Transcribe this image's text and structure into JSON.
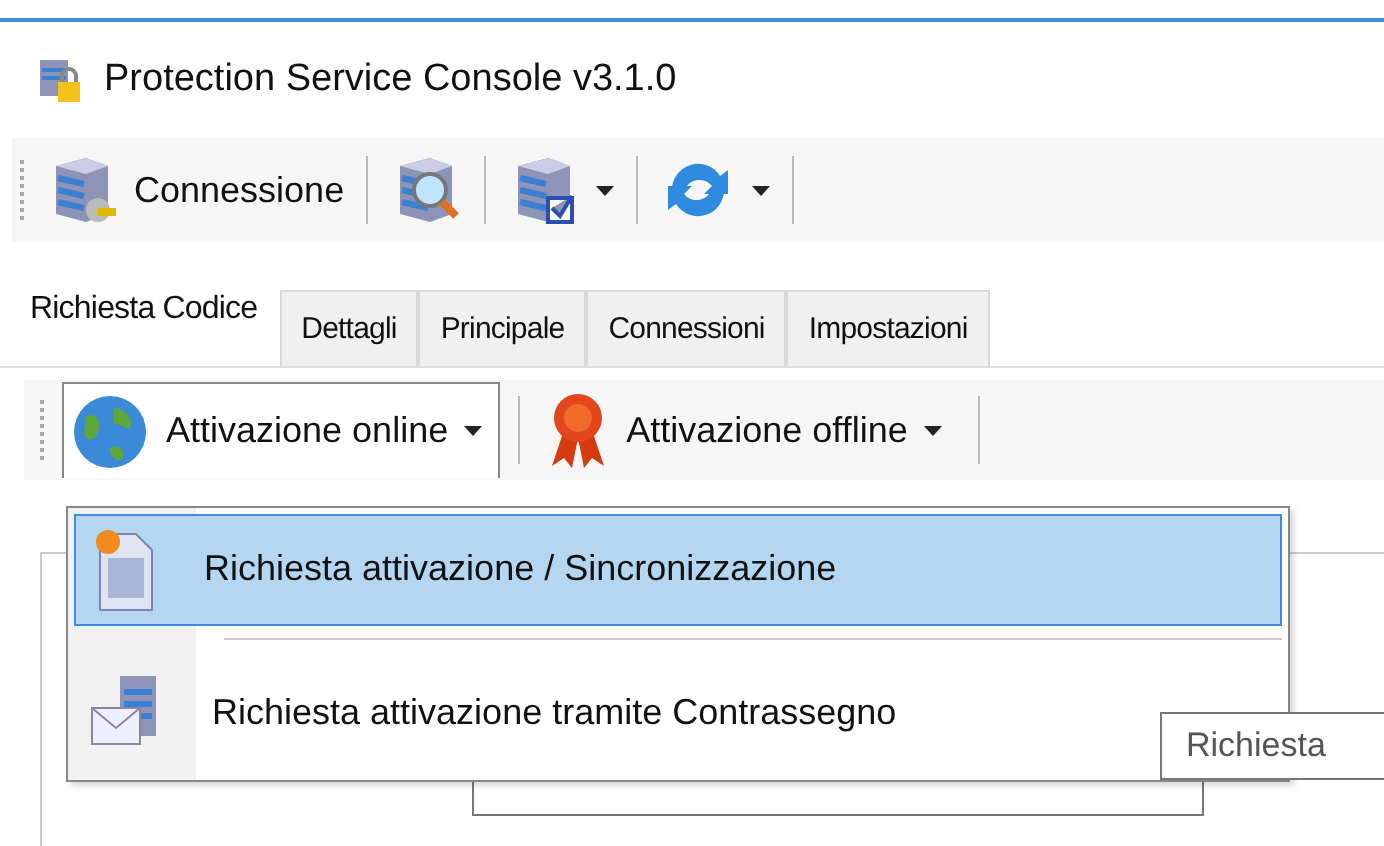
{
  "window": {
    "title": "Protection Service Console v3.1.0"
  },
  "toolbar": {
    "items": [
      {
        "kind": "labeled",
        "label": "Connessione",
        "dropdown": false
      },
      {
        "kind": "icon",
        "dropdown": false
      },
      {
        "kind": "icon",
        "dropdown": true
      },
      {
        "kind": "refresh",
        "dropdown": true
      }
    ]
  },
  "tabs": [
    {
      "label": "Richiesta Codice",
      "selected": true
    },
    {
      "label": "Dettagli",
      "selected": false
    },
    {
      "label": "Principale",
      "selected": false
    },
    {
      "label": "Connessioni",
      "selected": false
    },
    {
      "label": "Impostazioni",
      "selected": false
    }
  ],
  "activation_toolbar": [
    {
      "kind": "globe",
      "label": "Attivazione online",
      "open": true
    },
    {
      "kind": "ribbon",
      "label": "Attivazione offline",
      "open": false
    }
  ],
  "menu": {
    "items": [
      {
        "kind": "document",
        "label": "Richiesta attivazione / Sincronizzazione",
        "selected": true
      },
      {
        "kind": "mail",
        "label": "Richiesta attivazione tramite Contrassegno",
        "selected": false
      }
    ]
  },
  "tooltip": "Richiesta"
}
